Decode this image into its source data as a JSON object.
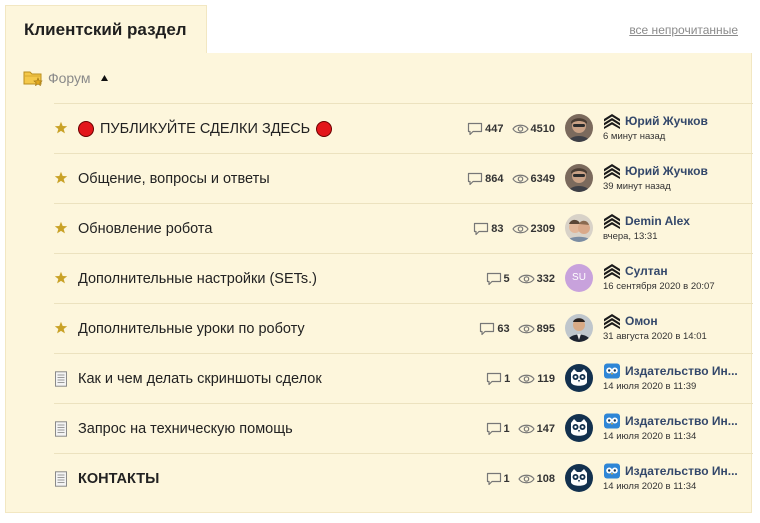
{
  "tabs": {
    "active_label": "Клиентский раздел",
    "unread_link": "все непрочитанные"
  },
  "header": {
    "forum_link": "Форум",
    "icons": [
      "folder-star-icon",
      "collapse-arrow-up-icon"
    ]
  },
  "colors": {
    "panel_bg": "#fdf6dc",
    "star": "#c9a227",
    "author_link": "#34486b",
    "marker_red": "#e3161b",
    "publisher_avatar": "#13314f"
  },
  "topics": [
    {
      "icon": "star-icon",
      "title": "ПУБЛИКУЙТЕ СДЕЛКИ ЗДЕСЬ",
      "markers": "red-circle",
      "bold": false,
      "replies": "447",
      "views": "4510",
      "author": "Юрий Жучков",
      "rank": "chevron-rank-icon",
      "time": "6 минут назад",
      "avatar": "photo-1"
    },
    {
      "icon": "star-icon",
      "title": "Общение, вопросы и ответы",
      "bold": false,
      "replies": "864",
      "views": "6349",
      "author": "Юрий Жучков",
      "rank": "chevron-rank-icon",
      "time": "39 минут назад",
      "avatar": "photo-1"
    },
    {
      "icon": "star-icon",
      "title": "Обновление робота",
      "bold": false,
      "replies": "83",
      "views": "2309",
      "author": "Demin Alex",
      "rank": "chevron-rank-icon",
      "time": "вчера, 13:31",
      "avatar": "photo-2"
    },
    {
      "icon": "star-icon",
      "title": "Дополнительные настройки (SETs.)",
      "bold": false,
      "replies": "5",
      "views": "332",
      "author": "Султан",
      "rank": "chevron-rank-icon",
      "time": "16 сентября 2020 в 20:07",
      "avatar": "initials",
      "initials": "SU"
    },
    {
      "icon": "star-icon",
      "title": "Дополнительные уроки по роботу",
      "bold": false,
      "replies": "63",
      "views": "895",
      "author": "Омон",
      "rank": "chevron-rank-icon",
      "time": "31 августа 2020 в 14:01",
      "avatar": "photo-3"
    },
    {
      "icon": "document-icon",
      "title": "Как и чем делать скриншоты сделок",
      "bold": false,
      "replies": "1",
      "views": "119",
      "author": "Издательство Ин...",
      "rank": "owl-badge-icon",
      "time": "14 июля 2020 в 11:39",
      "avatar": "owl"
    },
    {
      "icon": "document-icon",
      "title": "Запрос на техническую помощь",
      "bold": false,
      "replies": "1",
      "views": "147",
      "author": "Издательство Ин...",
      "rank": "owl-badge-icon",
      "time": "14 июля 2020 в 11:34",
      "avatar": "owl"
    },
    {
      "icon": "document-icon",
      "title": "КОНТАКТЫ",
      "bold": true,
      "replies": "1",
      "views": "108",
      "author": "Издательство Ин...",
      "rank": "owl-badge-icon",
      "time": "14 июля 2020 в 11:34",
      "avatar": "owl"
    }
  ]
}
